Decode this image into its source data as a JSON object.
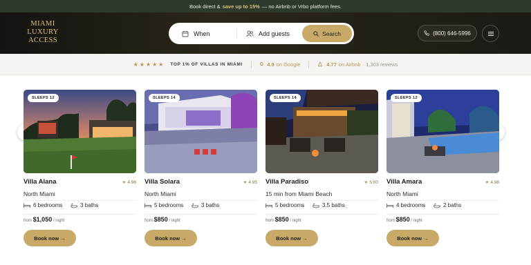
{
  "promo": {
    "prefix": "Book direct &",
    "highlight": "save up to 15%",
    "suffix": "— no Airbnb or Vrbo platform fees."
  },
  "logo": {
    "line1": "MIAMI",
    "line2": "LUXURY",
    "line3": "ACCESS"
  },
  "search": {
    "when_label": "When",
    "guests_label": "Add guests",
    "button_label": "Search"
  },
  "header": {
    "phone": "(800) 646-5996"
  },
  "trust": {
    "stars": "★★★★★",
    "top_label": "TOP 1% OF VILLAS IN MIAMI",
    "google_rating": "4.9",
    "google_label": "on Google",
    "airbnb_rating": "4.77",
    "airbnb_label": "on Airbnb",
    "airbnb_reviews": "· 1,303 reviews"
  },
  "villas": [
    {
      "badge": "SLEEPS 12",
      "name": "Villa Alana",
      "rating": "4.96",
      "location": "North Miami",
      "bedrooms": "6 bedrooms",
      "baths": "3 baths",
      "price_prefix": "from",
      "price": "$1,050",
      "price_suffix": "/ night",
      "cta": "Book now →"
    },
    {
      "badge": "SLEEPS 14",
      "name": "Villa Solara",
      "rating": "4.95",
      "location": "North Miami",
      "bedrooms": "5 bedrooms",
      "baths": "3 baths",
      "price_prefix": "from",
      "price": "$850",
      "price_suffix": "/ night",
      "cta": "Book now →"
    },
    {
      "badge": "SLEEPS 14",
      "name": "Villa Paradiso",
      "rating": "5.00",
      "location": "15 min from Miami Beach",
      "bedrooms": "5 bedrooms",
      "baths": "3.5 baths",
      "price_prefix": "from",
      "price": "$850",
      "price_suffix": "/ night",
      "cta": "Book now →"
    },
    {
      "badge": "SLEEPS 12",
      "name": "Villa Amara",
      "rating": "4.98",
      "location": "North Miami",
      "bedrooms": "4 bedrooms",
      "baths": "2 baths",
      "price_prefix": "from",
      "price": "$850",
      "price_suffix": "/ night",
      "cta": "Book now →"
    }
  ],
  "colors": {
    "accent": "#c8a967",
    "promo_bg": "#2d3a2c",
    "header_bg": "#1c1a15",
    "gold_text": "#b9955a"
  },
  "icons": {
    "when": "calendar-icon",
    "guests": "users-icon",
    "search": "search-icon",
    "phone": "phone-icon",
    "menu": "menu-icon",
    "prev": "chevron-left-icon",
    "next": "chevron-right-icon",
    "bed": "bed-icon",
    "bath": "bath-icon",
    "star": "star-icon"
  }
}
